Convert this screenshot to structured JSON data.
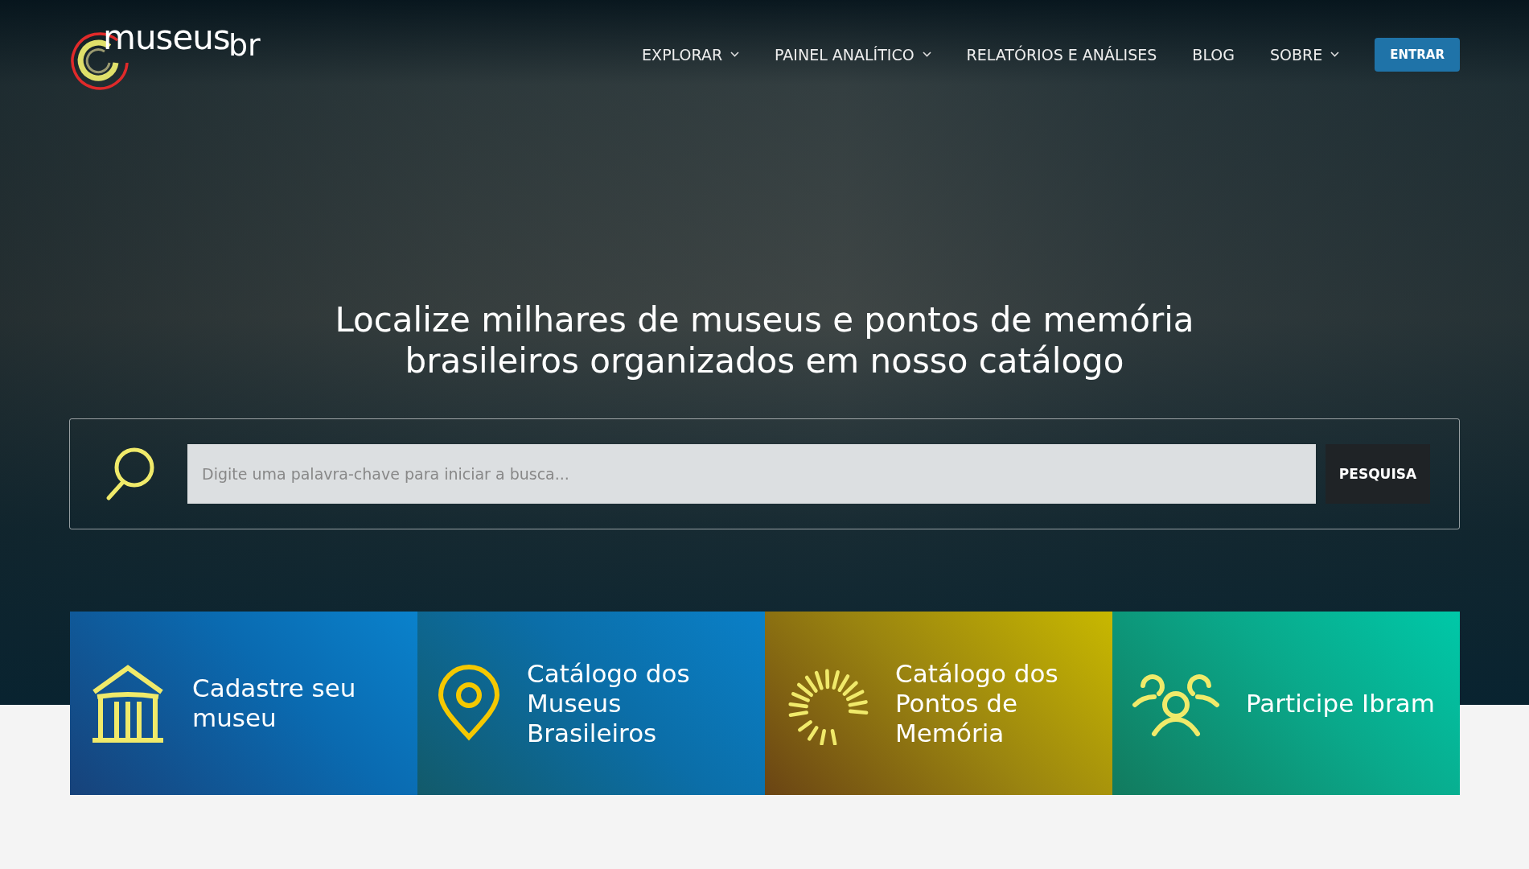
{
  "logo": {
    "main": "museus",
    "suffix": "br"
  },
  "nav": [
    {
      "label": "EXPLORAR",
      "dropdown": true
    },
    {
      "label": "PAINEL ANALÍTICO",
      "dropdown": true
    },
    {
      "label": "RELATÓRIOS E ANÁLISES",
      "dropdown": false
    },
    {
      "label": "BLOG",
      "dropdown": false
    },
    {
      "label": "SOBRE",
      "dropdown": true
    }
  ],
  "login_button": "ENTRAR",
  "headline": "Localize milhares de museus e pontos de memória brasileiros organizados em nosso catálogo",
  "search": {
    "placeholder": "Digite uma palavra-chave para iniciar a busca...",
    "button": "PESQUISA"
  },
  "cards": [
    {
      "kind": "museum",
      "label": "Cadastre seu museu"
    },
    {
      "kind": "pin",
      "label": "Catálogo dos Museus Brasileiros"
    },
    {
      "kind": "sun",
      "label": "Catálogo dos Pontos de Memória"
    },
    {
      "kind": "people",
      "label": "Participe Ibram"
    }
  ]
}
